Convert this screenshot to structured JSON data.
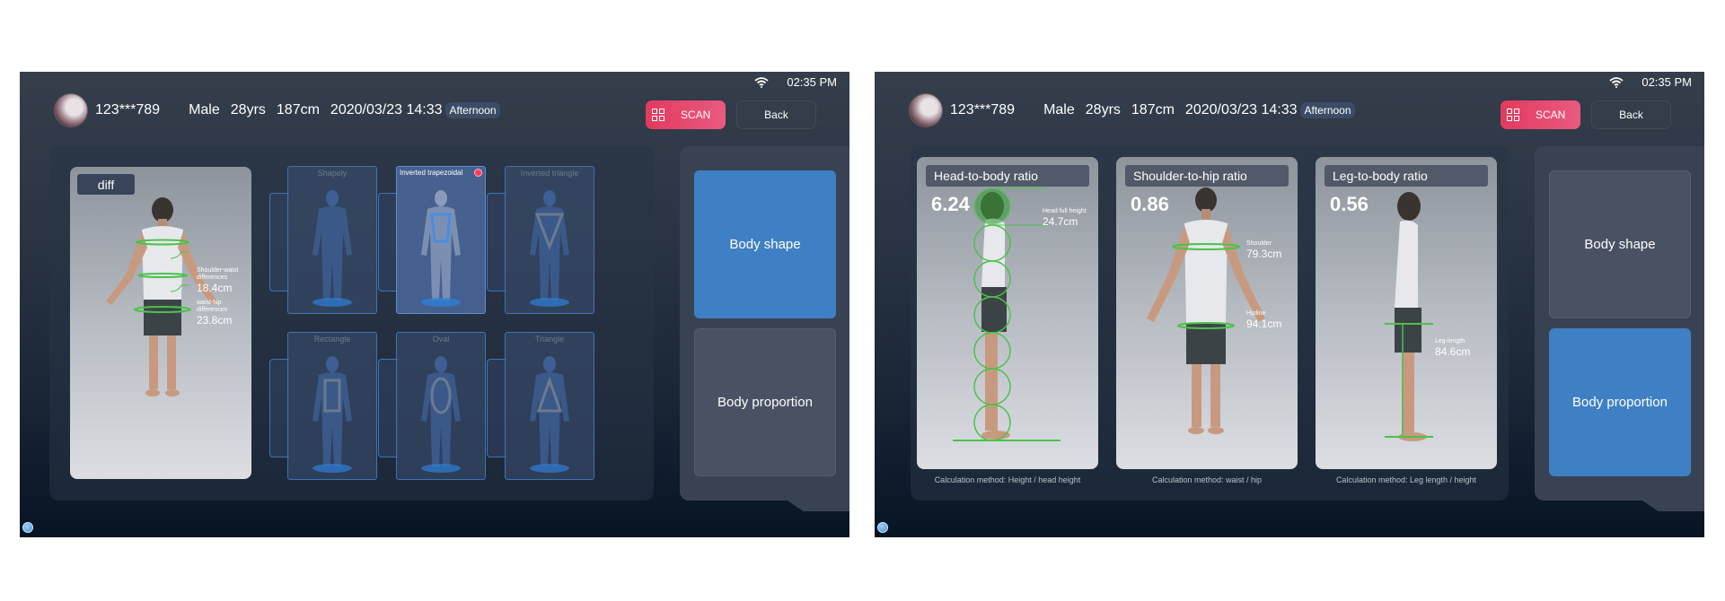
{
  "status": {
    "time": "02:35 PM",
    "wifi_icon": "wifi-icon"
  },
  "header": {
    "user_id": "123***789",
    "gender": "Male",
    "age": "28yrs",
    "height": "187cm",
    "datetime": "2020/03/23 14:33",
    "period": "Afternoon"
  },
  "buttons": {
    "scan": "SCAN",
    "back": "Back"
  },
  "sidebar": {
    "body_shape": "Body shape",
    "body_proportion": "Body proportion"
  },
  "left_screen": {
    "active_tab": "Body shape",
    "photo": {
      "tag": "diff",
      "measurements": [
        {
          "label": "Shoulder-waist differences",
          "value": "18.4cm"
        },
        {
          "label": "waist-hip differences",
          "value": "23.8cm"
        }
      ]
    },
    "shapes": [
      {
        "name": "Shapely",
        "selected": false
      },
      {
        "name": "Inverted trapezoidal",
        "selected": true
      },
      {
        "name": "Inverted triangle",
        "selected": false
      },
      {
        "name": "Rectangle",
        "selected": false
      },
      {
        "name": "Oval",
        "selected": false
      },
      {
        "name": "Triangle",
        "selected": false
      }
    ]
  },
  "right_screen": {
    "active_tab": "Body proportion",
    "ratios": [
      {
        "title": "Head-to-body ratio",
        "value": "6.24",
        "measure_label": "Head full height",
        "measure_value": "24.7cm",
        "calc": "Calculation method: Height / head height"
      },
      {
        "title": "Shoulder-to-hip ratio",
        "value": "0.86",
        "measure_label": "Shoulder",
        "measure_value": "79.3cm",
        "measure2_label": "Hipline",
        "measure2_value": "94.1cm",
        "calc": "Calculation method: waist / hip"
      },
      {
        "title": "Leg-to-body ratio",
        "value": "0.56",
        "measure_label": "Leg-length",
        "measure_value": "84.6cm",
        "calc": "Calculation method: Leg length / height"
      }
    ]
  },
  "colors": {
    "accent_blue": "#3f80c4",
    "scan_red": "#e23a5e",
    "measure_green": "#4cc24a"
  }
}
